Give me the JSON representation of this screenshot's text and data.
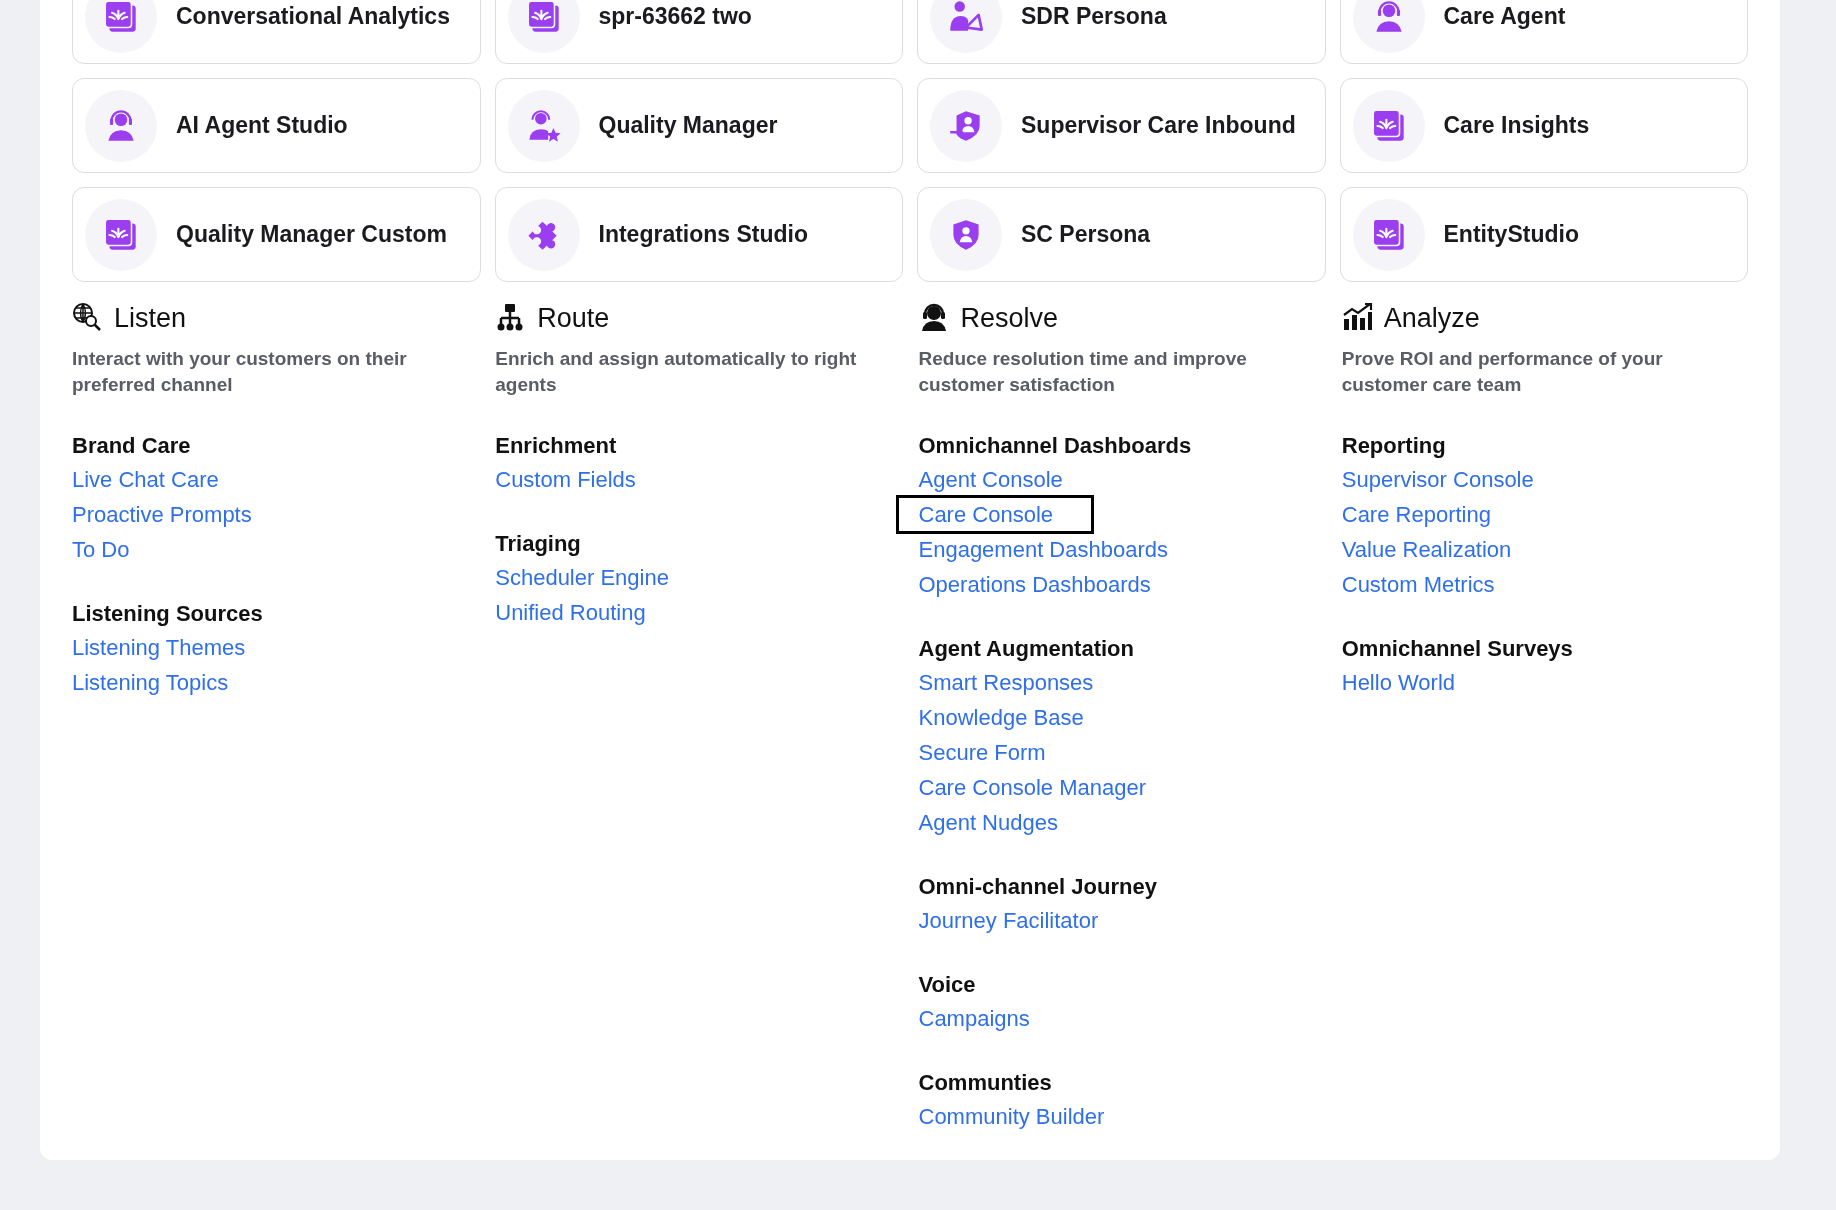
{
  "apps": [
    {
      "label": "Conversational Analytics",
      "kind": "app"
    },
    {
      "label": "spr-63662 two",
      "kind": "app"
    },
    {
      "label": "SDR Persona",
      "kind": "megaphone"
    },
    {
      "label": "Care Agent",
      "kind": "headset"
    },
    {
      "label": "AI Agent Studio",
      "kind": "headset"
    },
    {
      "label": "Quality Manager",
      "kind": "star"
    },
    {
      "label": "Supervisor Care Inbound",
      "kind": "inbound"
    },
    {
      "label": "Care Insights",
      "kind": "app"
    },
    {
      "label": "Quality Manager Custom",
      "kind": "app"
    },
    {
      "label": "Integrations Studio",
      "kind": "puzzle"
    },
    {
      "label": "SC Persona",
      "kind": "shield"
    },
    {
      "label": "EntityStudio",
      "kind": "app"
    }
  ],
  "sections": [
    {
      "title": "Listen",
      "kind": "listen",
      "description": "Interact with your customers on their preferred channel",
      "groups": [
        {
          "title": "Brand Care",
          "links": [
            {
              "label": "Live Chat Care",
              "selected": false
            },
            {
              "label": "Proactive Prompts",
              "selected": false
            },
            {
              "label": "To Do",
              "selected": false
            }
          ]
        },
        {
          "title": "Listening Sources",
          "links": [
            {
              "label": "Listening Themes",
              "selected": false
            },
            {
              "label": "Listening Topics",
              "selected": false
            }
          ]
        }
      ]
    },
    {
      "title": "Route",
      "kind": "route",
      "description": "Enrich and assign automatically to right agents",
      "groups": [
        {
          "title": "Enrichment",
          "links": [
            {
              "label": "Custom Fields",
              "selected": false
            }
          ]
        },
        {
          "title": "Triaging",
          "links": [
            {
              "label": "Scheduler Engine",
              "selected": false
            },
            {
              "label": "Unified Routing",
              "selected": false
            }
          ]
        }
      ]
    },
    {
      "title": "Resolve",
      "kind": "resolve",
      "description": "Reduce resolution time and improve customer satisfaction",
      "groups": [
        {
          "title": "Omnichannel Dashboards",
          "links": [
            {
              "label": "Agent Console",
              "selected": false
            },
            {
              "label": "Care Console",
              "selected": true
            },
            {
              "label": "Engagement Dashboards",
              "selected": false
            },
            {
              "label": "Operations Dashboards",
              "selected": false
            }
          ]
        },
        {
          "title": "Agent Augmentation",
          "links": [
            {
              "label": "Smart Responses",
              "selected": false
            },
            {
              "label": "Knowledge Base",
              "selected": false
            },
            {
              "label": "Secure Form",
              "selected": false
            },
            {
              "label": "Care Console Manager",
              "selected": false
            },
            {
              "label": "Agent Nudges",
              "selected": false
            }
          ]
        },
        {
          "title": "Omni-channel Journey",
          "links": [
            {
              "label": "Journey Facilitator",
              "selected": false
            }
          ]
        },
        {
          "title": "Voice",
          "links": [
            {
              "label": "Campaigns",
              "selected": false
            }
          ]
        },
        {
          "title": "Communties",
          "links": [
            {
              "label": "Community Builder",
              "selected": false
            }
          ]
        }
      ]
    },
    {
      "title": "Analyze",
      "kind": "analyze",
      "description": "Prove ROI and performance of your customer care team",
      "groups": [
        {
          "title": "Reporting",
          "links": [
            {
              "label": "Supervisor Console",
              "selected": false
            },
            {
              "label": "Care Reporting",
              "selected": false
            },
            {
              "label": "Value Realization",
              "selected": false
            },
            {
              "label": "Custom Metrics",
              "selected": false
            }
          ]
        },
        {
          "title": "Omnichannel Surveys",
          "links": [
            {
              "label": "Hello World",
              "selected": false
            }
          ]
        }
      ]
    }
  ]
}
